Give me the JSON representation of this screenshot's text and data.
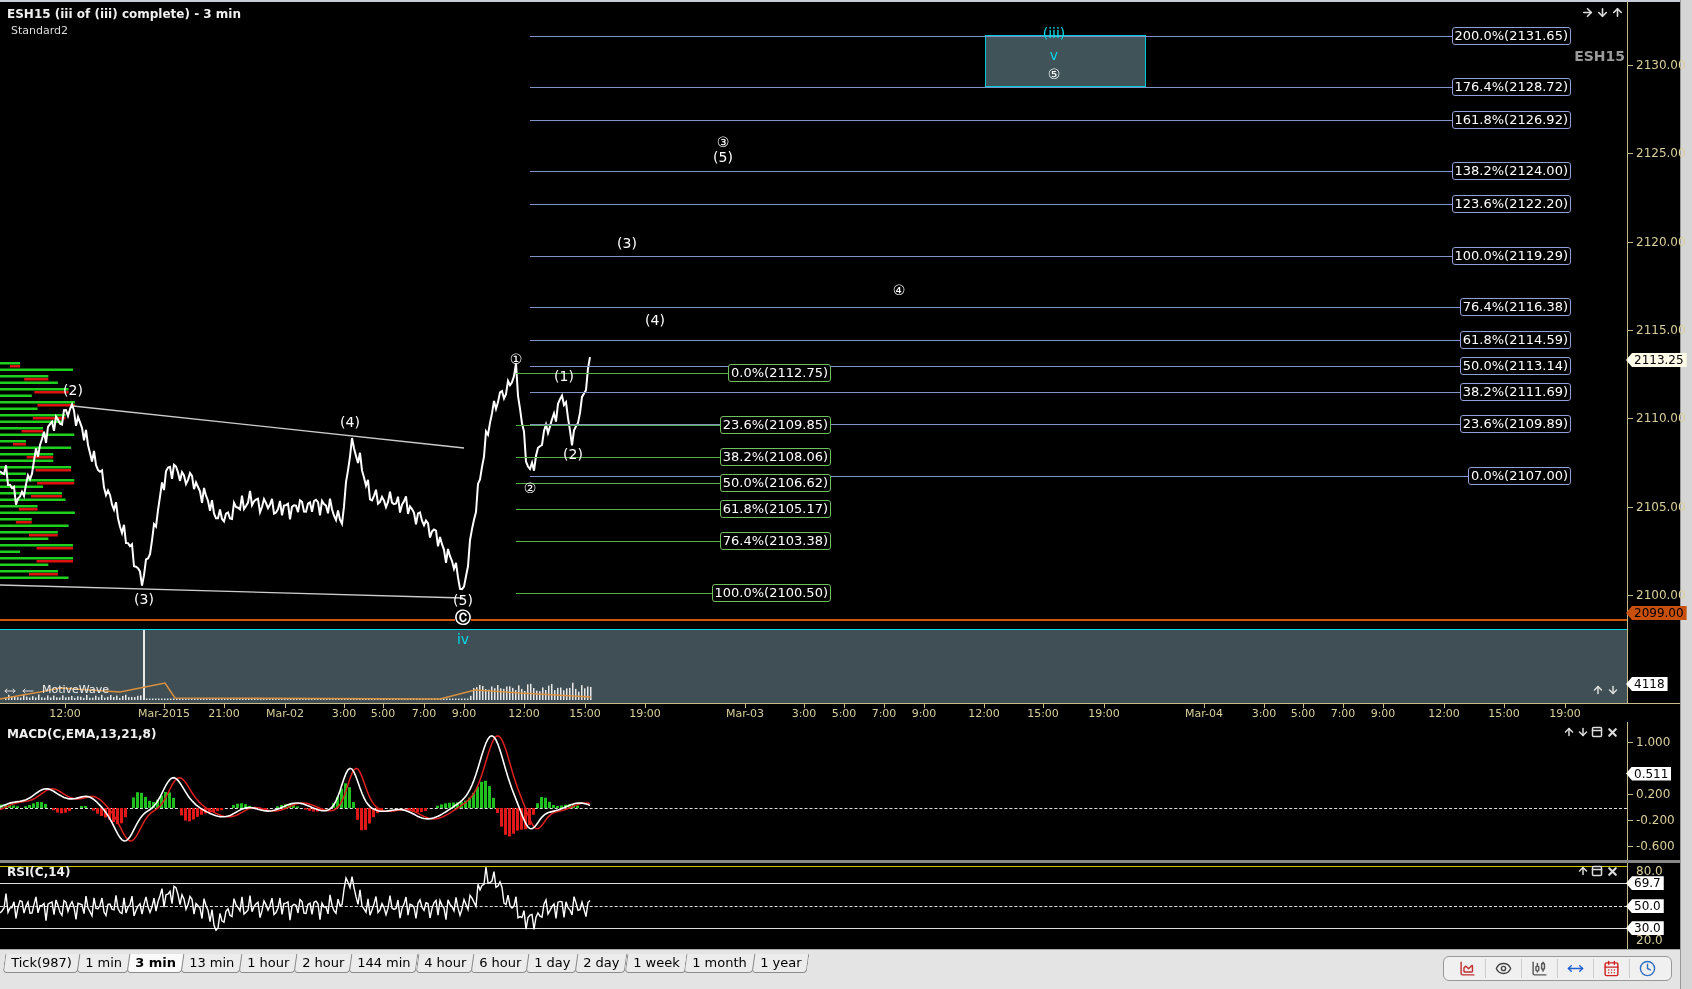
{
  "chart": {
    "title": "ESH15 (iii of (iii) complete) - 3 min",
    "template": "Standard2",
    "watermark": "ESH15",
    "price_axis": [
      "2130.00",
      "2125.00",
      "2120.00",
      "2115.00",
      "2110.00",
      "2105.00",
      "2100.00"
    ],
    "last_price": "2113.25",
    "marker_price": "2099.00",
    "volume_tag": "4118",
    "volume_label": "MotiveWave",
    "fib_extension": [
      "200.0%(2131.65)",
      "176.4%(2128.72)",
      "161.8%(2126.92)",
      "138.2%(2124.00)",
      "123.6%(2122.20)",
      "100.0%(2119.29)",
      "76.4%(2116.38)",
      "61.8%(2114.59)",
      "50.0%(2113.14)",
      "38.2%(2111.69)",
      "23.6%(2109.89)",
      "0.0%(2107.00)"
    ],
    "fib_retracement": [
      "0.0%(2112.75)",
      "23.6%(2109.85)",
      "38.2%(2108.06)",
      "50.0%(2106.62)",
      "61.8%(2105.17)",
      "76.4%(2103.38)",
      "100.0%(2100.50)"
    ],
    "wave_labels": [
      {
        "text": "(iii)",
        "color": "#00d8e8"
      },
      {
        "text": "v",
        "color": "#00d8e8"
      },
      {
        "text": "⑤",
        "color": "#ffffff"
      },
      {
        "text": "③",
        "color": "#ffffff"
      },
      {
        "text": "(5)",
        "color": "#ffffff"
      },
      {
        "text": "(3)",
        "color": "#ffffff"
      },
      {
        "text": "④",
        "color": "#ffffff"
      },
      {
        "text": "(4)",
        "color": "#ffffff"
      },
      {
        "text": "①",
        "color": "#ffffff"
      },
      {
        "text": "(1)",
        "color": "#ffffff"
      },
      {
        "text": "(2)",
        "color": "#ffffff"
      },
      {
        "text": "②",
        "color": "#ffffff"
      },
      {
        "text": "(2)",
        "color": "#ffffff"
      },
      {
        "text": "(4)",
        "color": "#ffffff"
      },
      {
        "text": "(3)",
        "color": "#ffffff"
      },
      {
        "text": "(5)",
        "color": "#ffffff"
      },
      {
        "text": "Ⓒ",
        "color": "#ffffff"
      },
      {
        "text": "iv",
        "color": "#00d8e8"
      }
    ],
    "time_axis": [
      "12:00",
      "Mar-2015",
      "21:00",
      "Mar-02",
      "3:00",
      "5:00",
      "7:00",
      "9:00",
      "12:00",
      "15:00",
      "19:00",
      "Mar-03",
      "3:00",
      "5:00",
      "7:00",
      "9:00",
      "12:00",
      "15:00",
      "19:00",
      "Mar-04",
      "3:00",
      "5:00",
      "7:00",
      "9:00",
      "12:00",
      "15:00",
      "19:00"
    ]
  },
  "macd": {
    "title": "MACD(C,EMA,13,21,8)",
    "axis": [
      "1.000",
      "0.200",
      "-0.200",
      "-0.600"
    ],
    "value_tag": "0.511"
  },
  "rsi": {
    "title": "RSI(C,14)",
    "axis": [
      "80.0",
      "20.0"
    ],
    "tags": [
      "69.7",
      "50.0",
      "30.0"
    ]
  },
  "timeframe_tabs": [
    {
      "label": "Tick(987)",
      "selected": false
    },
    {
      "label": "1 min",
      "selected": false
    },
    {
      "label": "3 min",
      "selected": true
    },
    {
      "label": "13 min",
      "selected": false
    },
    {
      "label": "1 hour",
      "selected": false
    },
    {
      "label": "2 hour",
      "selected": false
    },
    {
      "label": "144 min",
      "selected": false
    },
    {
      "label": "4 hour",
      "selected": false
    },
    {
      "label": "6 hour",
      "selected": false
    },
    {
      "label": "1 day",
      "selected": false
    },
    {
      "label": "2 day",
      "selected": false
    },
    {
      "label": "1 week",
      "selected": false
    },
    {
      "label": "1 month",
      "selected": false
    },
    {
      "label": "1 year",
      "selected": false
    }
  ]
}
